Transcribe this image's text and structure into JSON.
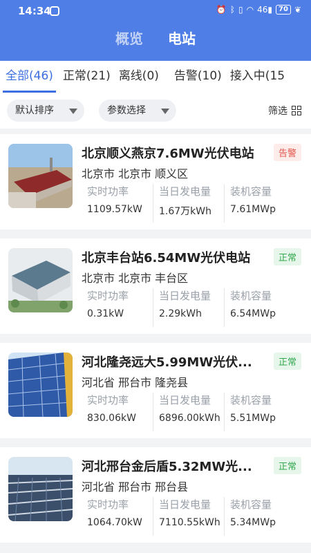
{
  "status_bar": {
    "time": "14:34",
    "battery": "70",
    "signal_text": "46",
    "icons": [
      "alarm-icon",
      "bluetooth-icon",
      "vibrate-icon",
      "wifi-icon",
      "signal-icon",
      "battery-icon",
      "leaf-icon"
    ]
  },
  "top_tabs": [
    {
      "label": "概览",
      "active": false
    },
    {
      "label": "电站",
      "active": true
    }
  ],
  "filter_tabs": [
    {
      "label": "全部(46)",
      "active": true
    },
    {
      "label": "正常(21)",
      "active": false
    },
    {
      "label": "离线(0)",
      "active": false
    },
    {
      "label": "告警(10)",
      "active": false
    },
    {
      "label": "接入中(15",
      "active": false
    }
  ],
  "toolbar": {
    "sort_label": "默认排序",
    "param_label": "参数选择",
    "filter_label": "筛选"
  },
  "colors": {
    "header": "#4f7ee6",
    "accent": "#3d6fe0",
    "alarm": "#e4534a",
    "normal": "#32a84e"
  },
  "stations": [
    {
      "name": "北京顺义燕京7.6MW光伏电站",
      "location": "北京市 北京市 顺义区",
      "status": "告警",
      "status_type": "alarm",
      "metrics": [
        {
          "label": "实时功率",
          "value": "1109.57kW"
        },
        {
          "label": "当日发电量",
          "value": "1.67万kWh"
        },
        {
          "label": "装机容量",
          "value": "7.61MWp"
        }
      ]
    },
    {
      "name": "北京丰台站6.54MW光伏电站",
      "location": "北京市 北京市 丰台区",
      "status": "正常",
      "status_type": "normal",
      "metrics": [
        {
          "label": "实时功率",
          "value": "0.31kW"
        },
        {
          "label": "当日发电量",
          "value": "2.29kWh"
        },
        {
          "label": "装机容量",
          "value": "6.54MWp"
        }
      ]
    },
    {
      "name": "河北隆尧远大5.99MW光伏...",
      "location": "河北省 邢台市 隆尧县",
      "status": "正常",
      "status_type": "normal",
      "metrics": [
        {
          "label": "实时功率",
          "value": "830.06kW"
        },
        {
          "label": "当日发电量",
          "value": "6896.00kWh"
        },
        {
          "label": "装机容量",
          "value": "5.51MWp"
        }
      ]
    },
    {
      "name": "河北邢台金后盾5.32MW光...",
      "location": "河北省 邢台市 邢台县",
      "status": "正常",
      "status_type": "normal",
      "metrics": [
        {
          "label": "实时功率",
          "value": "1064.70kW"
        },
        {
          "label": "当日发电量",
          "value": "7110.55kWh"
        },
        {
          "label": "装机容量",
          "value": "5.34MWp"
        }
      ]
    }
  ]
}
